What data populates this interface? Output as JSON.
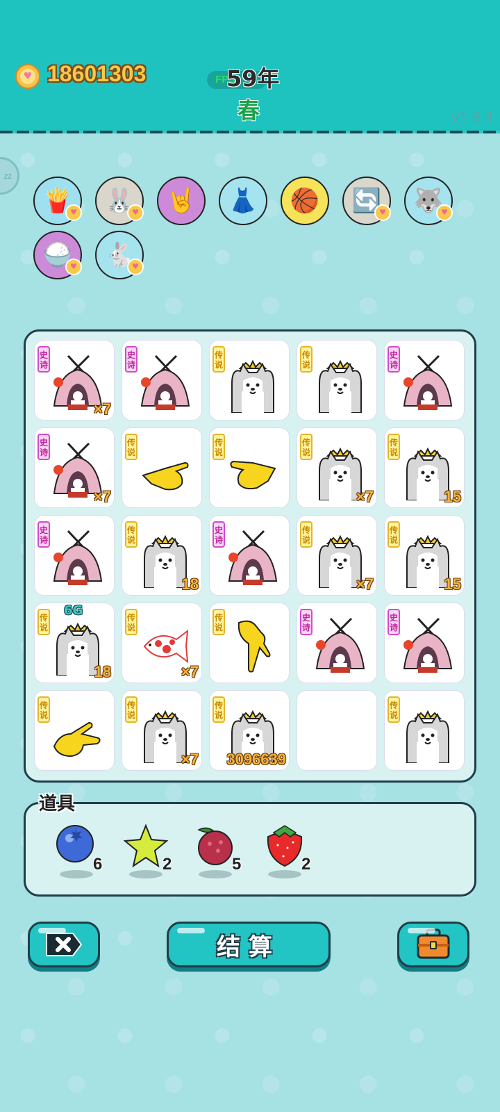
{
  "header": {
    "coins": "18601303",
    "fps_label": "FPS:",
    "year": "59年",
    "season": "春",
    "version": "v1.5.4"
  },
  "side_button": {
    "label": "zz"
  },
  "buffs": [
    {
      "icon": "fries-icon",
      "bg": "#9ee0ef",
      "heart": true,
      "glyph": "🍟"
    },
    {
      "icon": "rabbit-icon",
      "bg": "#d9d6cc",
      "heart": true,
      "glyph": "🐰"
    },
    {
      "icon": "rock-hand-icon",
      "bg": "#cc8ad8",
      "heart": false,
      "glyph": "🤘"
    },
    {
      "icon": "skirt-icon",
      "bg": "#a5e4ef",
      "heart": false,
      "glyph": "👗"
    },
    {
      "icon": "basketballs-icon",
      "bg": "#f5e35a",
      "heart": false,
      "glyph": "🏀"
    },
    {
      "icon": "refresh-icon",
      "bg": "#d9d6cc",
      "heart": true,
      "glyph": "🔄"
    },
    {
      "icon": "husky-icon",
      "bg": "#a5e4ef",
      "heart": true,
      "glyph": "🐺"
    },
    {
      "icon": "rice-bowl-icon",
      "bg": "#cc8ad8",
      "heart": true,
      "glyph": "🍚"
    },
    {
      "icon": "rabbit-standing-icon",
      "bg": "#a5e4ef",
      "heart": true,
      "glyph": "🐇"
    }
  ],
  "tags": {
    "legend": "传说",
    "epic": "史诗"
  },
  "board": [
    [
      {
        "type": "tent",
        "tag": "epic",
        "count": "×7"
      },
      {
        "type": "tent",
        "tag": "epic",
        "count": ""
      },
      {
        "type": "husky",
        "tag": "legend",
        "count": ""
      },
      {
        "type": "husky",
        "tag": "legend",
        "count": ""
      },
      {
        "type": "tent",
        "tag": "epic",
        "count": ""
      }
    ],
    [
      {
        "type": "tent",
        "tag": "epic",
        "count": "×7"
      },
      {
        "type": "hand-right",
        "tag": "legend",
        "count": ""
      },
      {
        "type": "hand-left",
        "tag": "legend",
        "count": ""
      },
      {
        "type": "husky",
        "tag": "legend",
        "count": "×7"
      },
      {
        "type": "husky",
        "tag": "legend",
        "count": "15"
      }
    ],
    [
      {
        "type": "tent",
        "tag": "epic",
        "count": ""
      },
      {
        "type": "husky",
        "tag": "legend",
        "count": "18"
      },
      {
        "type": "tent",
        "tag": "epic",
        "count": ""
      },
      {
        "type": "husky",
        "tag": "legend",
        "count": "×7"
      },
      {
        "type": "husky",
        "tag": "legend",
        "count": "15"
      }
    ],
    [
      {
        "type": "husky",
        "tag": "legend",
        "count": "18",
        "badge": "6G"
      },
      {
        "type": "fish",
        "tag": "legend",
        "count": "×7"
      },
      {
        "type": "hand-down",
        "tag": "legend",
        "count": ""
      },
      {
        "type": "tent",
        "tag": "epic",
        "count": ""
      },
      {
        "type": "tent",
        "tag": "epic",
        "count": ""
      }
    ],
    [
      {
        "type": "hand-rock",
        "tag": "legend",
        "count": ""
      },
      {
        "type": "husky",
        "tag": "legend",
        "count": "×7"
      },
      {
        "type": "husky",
        "tag": "legend",
        "count": "3096639"
      },
      {
        "type": "empty",
        "tag": "",
        "count": ""
      },
      {
        "type": "husky",
        "tag": "legend",
        "count": ""
      }
    ]
  ],
  "items_panel": {
    "title": "道具",
    "items": [
      {
        "icon": "blueberry-icon",
        "qty": "6"
      },
      {
        "icon": "star-icon",
        "qty": "2"
      },
      {
        "icon": "lychee-icon",
        "qty": "5"
      },
      {
        "icon": "strawberry-icon",
        "qty": "2"
      }
    ]
  },
  "buttons": {
    "settle_label": "结算"
  }
}
